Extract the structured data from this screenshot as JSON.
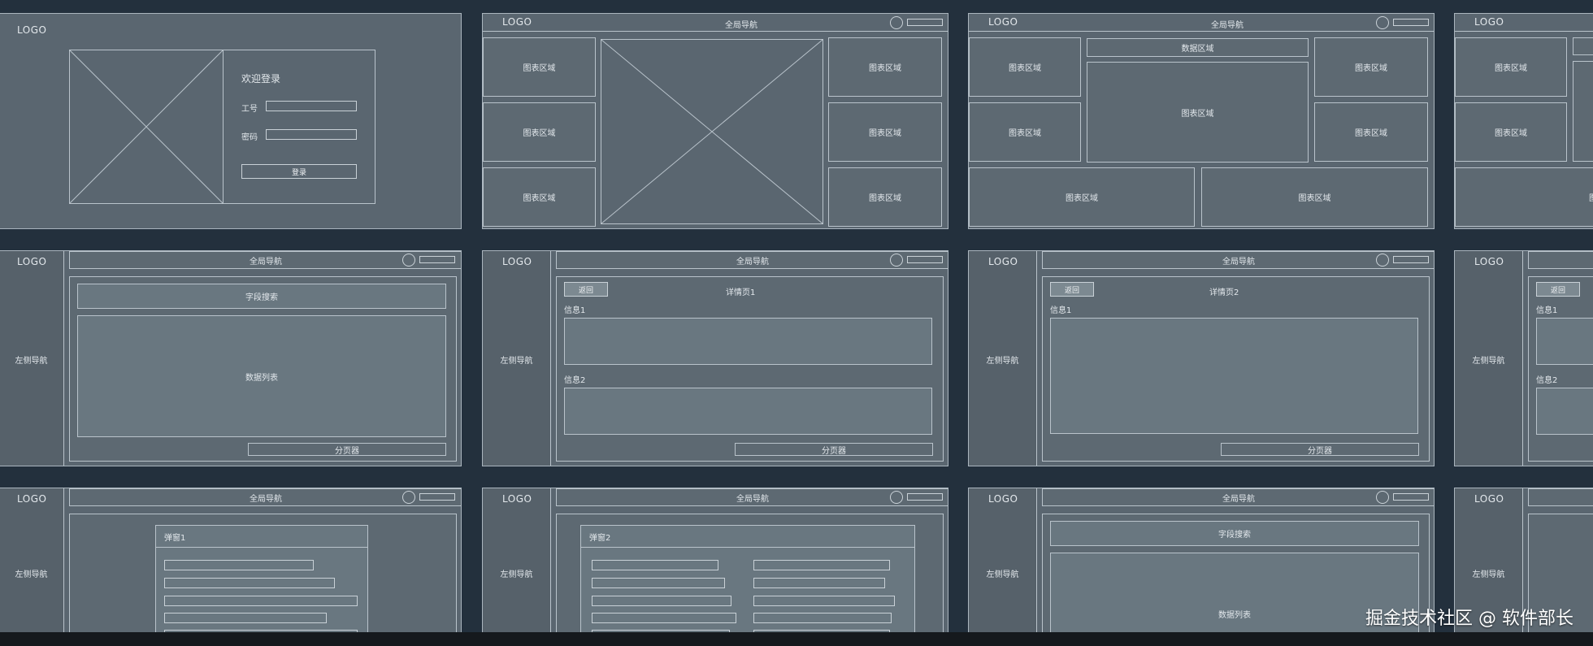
{
  "login": {
    "logo": "LOGO",
    "welcome": "欢迎登录",
    "id_label": "工号",
    "pwd_label": "密码",
    "button": "登录"
  },
  "common": {
    "logo": "LOGO",
    "global_nav": "全局导航",
    "chart_area": "图表区域",
    "data_area": "数据区域",
    "left_nav": "左侧导航",
    "field_search": "字段搜索",
    "data_list": "数据列表",
    "pager": "分页器",
    "back": "返回"
  },
  "detail1": {
    "title": "详情页1",
    "info1": "信息1",
    "info2": "信息2"
  },
  "detail2": {
    "title": "详情页2",
    "info1": "信息1"
  },
  "detail3": {
    "info1": "信息1",
    "info2": "信息2"
  },
  "modal1": {
    "title": "弹窗1"
  },
  "modal2": {
    "title": "弹窗2"
  },
  "watermark": "掘金技术社区 @ 软件部长"
}
